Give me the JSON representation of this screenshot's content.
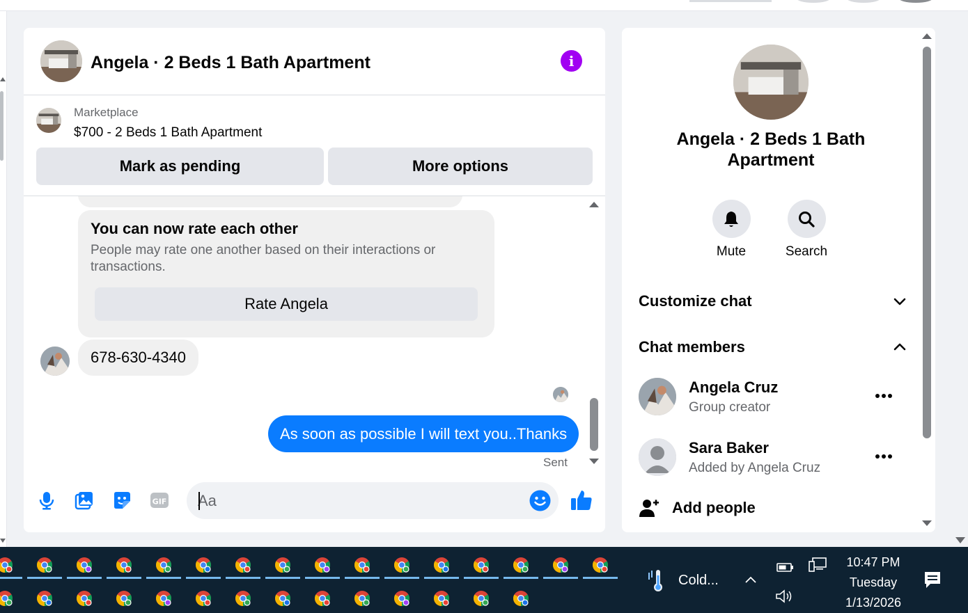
{
  "colors": {
    "accent_blue": "#0a7cff",
    "info_purple": "#a100f2",
    "taskbar_bg": "#0e2232"
  },
  "chat": {
    "title": "Angela · 2 Beds 1 Bath Apartment",
    "info_icon": "info-icon",
    "marketplace": {
      "label": "Marketplace",
      "listing": "$700 - 2 Beds 1 Bath Apartment",
      "mark_pending_label": "Mark as pending",
      "more_options_label": "More options"
    },
    "rate_card": {
      "title": "You can now rate each other",
      "description": "People may rate one another based on their interactions or transactions.",
      "button_label": "Rate Angela"
    },
    "received_message": "678-630-4340",
    "sent_message": "As soon as possible I will text you..Thanks",
    "sent_status": "Sent",
    "composer": {
      "placeholder": "Aa",
      "icons": [
        "microphone-icon",
        "photo-icon",
        "sticker-icon",
        "gif-icon",
        "emoji-icon",
        "thumbs-up-icon"
      ]
    }
  },
  "info_panel": {
    "title": "Angela · 2 Beds 1 Bath Apartment",
    "actions": [
      {
        "label": "Mute",
        "icon": "bell-icon"
      },
      {
        "label": "Search",
        "icon": "search-icon"
      }
    ],
    "sections": {
      "customize": "Customize chat",
      "members": "Chat members"
    },
    "members": [
      {
        "name": "Angela Cruz",
        "role": "Group creator"
      },
      {
        "name": "Sara Baker",
        "role": "Added by Angela Cruz"
      }
    ],
    "add_people": "Add people"
  },
  "taskbar": {
    "weather": "Cold...",
    "time": "10:47 PM",
    "day": "Tuesday",
    "date": "1/13/2026",
    "tray_icons": [
      "battery-icon",
      "network-icon",
      "volume-icon"
    ],
    "row1_apps": 16,
    "row2_apps": 14
  }
}
